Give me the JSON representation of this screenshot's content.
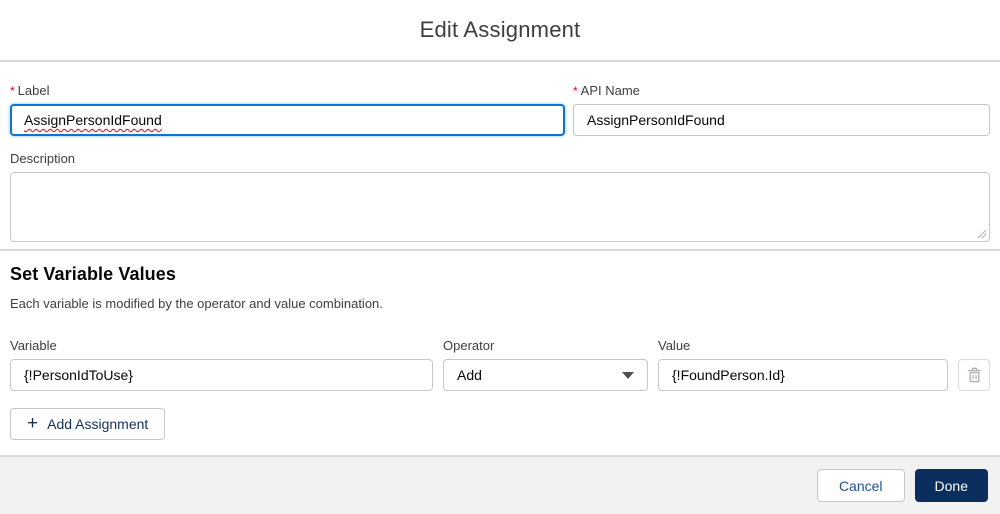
{
  "dialog": {
    "title": "Edit Assignment"
  },
  "fields": {
    "label": {
      "required_marker": "*",
      "label": "Label",
      "value": "AssignPersonIdFound"
    },
    "api_name": {
      "required_marker": "*",
      "label": "API Name",
      "value": "AssignPersonIdFound"
    },
    "description": {
      "label": "Description",
      "value": ""
    }
  },
  "section": {
    "heading": "Set Variable Values",
    "subtitle": "Each variable is modified by the operator and value combination."
  },
  "assignment_row": {
    "variable": {
      "label": "Variable",
      "value": "{!PersonIdToUse}"
    },
    "operator": {
      "label": "Operator",
      "selected": "Add"
    },
    "value": {
      "label": "Value",
      "value": "{!FoundPerson.Id}"
    },
    "delete_icon": "trash-icon"
  },
  "buttons": {
    "add_assignment_label": "Add Assignment",
    "add_assignment_icon": "+",
    "cancel_label": "Cancel",
    "done_label": "Done"
  },
  "colors": {
    "focus_border_blue": "#0b76d2",
    "required_red": "#ea001e",
    "squiggle_red": "#ea001e",
    "done_button_navy": "#0b2e5f",
    "link_button_blue": "#1b5297",
    "add_button_navy": "#16325c",
    "input_border_gray": "#c9c7c5",
    "divider_gray": "#d9d9d9",
    "footer_bg": "#f3f2f2",
    "disabled_icon_gray": "#b0adab"
  }
}
